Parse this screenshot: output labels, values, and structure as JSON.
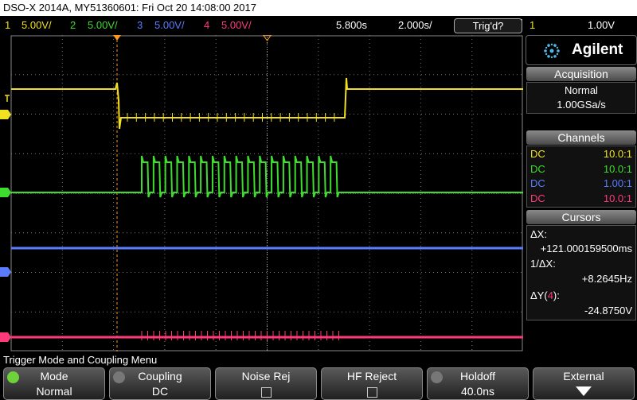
{
  "title": {
    "model": "DSO-X 2014A, MY51360601: Fri Oct 20 14:08:00 2017"
  },
  "status": {
    "channels": [
      {
        "num": "1",
        "scale": "5.00V/",
        "color": "#f0e020"
      },
      {
        "num": "2",
        "scale": "5.00V/",
        "color": "#3ddc2e"
      },
      {
        "num": "3",
        "scale": "5.00V/",
        "color": "#5b7cff"
      },
      {
        "num": "4",
        "scale": "5.00V/",
        "color": "#ff3a7a"
      }
    ],
    "time_delay": "5.800s",
    "time_scale": "2.000s/",
    "trig_state": "Trig'd?",
    "trig_source": "1",
    "trig_level": "1.00V"
  },
  "brand": {
    "name": "Agilent"
  },
  "acquisition": {
    "header": "Acquisition",
    "mode": "Normal",
    "rate": "1.00GSa/s"
  },
  "channels_panel": {
    "header": "Channels",
    "rows": [
      {
        "coupling": "DC",
        "probe": "10.0:1",
        "color": "#f0e020"
      },
      {
        "coupling": "DC",
        "probe": "10.0:1",
        "color": "#3ddc2e"
      },
      {
        "coupling": "DC",
        "probe": "1.00:1",
        "color": "#5b7cff"
      },
      {
        "coupling": "DC",
        "probe": "10.0:1",
        "color": "#ff3a7a"
      }
    ]
  },
  "cursors": {
    "header": "Cursors",
    "dx_label": "ΔX:",
    "dx_value": "+121.000159500ms",
    "inv_label": "1/ΔX:",
    "inv_value": "+8.2645Hz",
    "dy_label": "ΔY(",
    "dy_channel": "4",
    "dy_close": "):",
    "dy_value": "-24.8750V"
  },
  "menu": {
    "title": "Trigger Mode and Coupling Menu",
    "keys": [
      {
        "top": "Mode",
        "bottom": "Normal"
      },
      {
        "top": "Coupling",
        "bottom": "DC"
      },
      {
        "top": "Noise Rej",
        "bottom": ""
      },
      {
        "top": "HF Reject",
        "bottom": ""
      },
      {
        "top": "Holdoff",
        "bottom": "40.0ns"
      },
      {
        "top": "External",
        "bottom": ""
      }
    ]
  },
  "colors": {
    "ch1": "#f0e020",
    "ch2": "#3ddc2e",
    "ch3": "#5b7cff",
    "ch4": "#ff3a7a",
    "trigger_marker": "#ff9a1a",
    "grid": "#7a7a7a"
  },
  "waveform": {
    "ch1_low_start_s": 0.0,
    "ch1_low_end_s": 0.121,
    "ch2_burst_pulses": 17
  }
}
